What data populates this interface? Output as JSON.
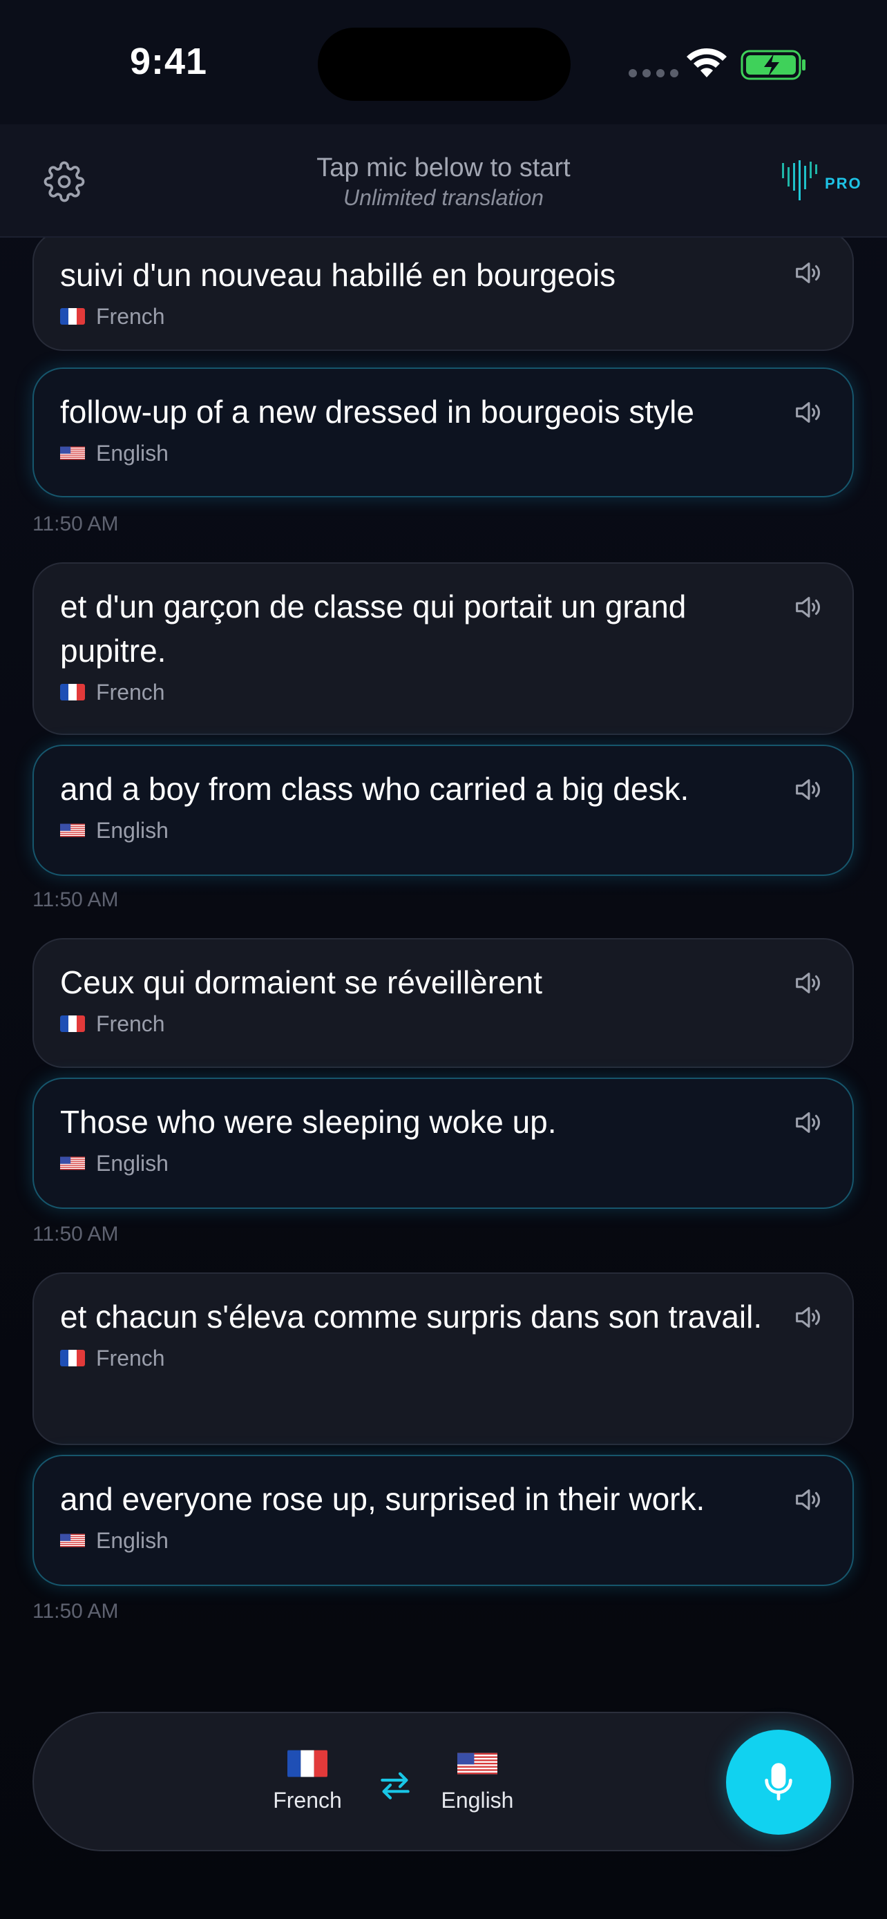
{
  "status_bar": {
    "time": "9:41"
  },
  "header": {
    "title": "Tap mic below to start",
    "subtitle": "Unlimited translation",
    "pro_label": "PRO"
  },
  "messages": [
    {
      "source_text": "suivi d'un nouveau habillé en bourgeois",
      "source_lang": "French",
      "target_text": "follow-up of a new dressed in bourgeois style",
      "target_lang": "English",
      "time": "11:50 AM"
    },
    {
      "source_text": "et d'un garçon de classe qui portait un grand pupitre.",
      "source_lang": "French",
      "target_text": "and a boy from class who carried a big desk.",
      "target_lang": "English",
      "time": "11:50 AM"
    },
    {
      "source_text": "Ceux qui dormaient se réveillèrent",
      "source_lang": "French",
      "target_text": "Those who were sleeping woke up.",
      "target_lang": "English",
      "time": "11:50 AM"
    },
    {
      "source_text": "et chacun s'éleva comme surpris dans son travail.",
      "source_lang": "French",
      "target_text": "and everyone rose up, surprised in their work.",
      "target_lang": "English",
      "time": "11:50 AM"
    }
  ],
  "bottom_bar": {
    "from_language": "French",
    "to_language": "English"
  },
  "icons": {
    "settings": "gear-icon",
    "speaker": "speaker-icon",
    "swap": "swap-arrows-icon",
    "mic": "microphone-icon",
    "logo": "pro-logo-icon"
  },
  "colors": {
    "accent": "#11d2f0",
    "target_border": "#16566c",
    "background": "#070912"
  }
}
